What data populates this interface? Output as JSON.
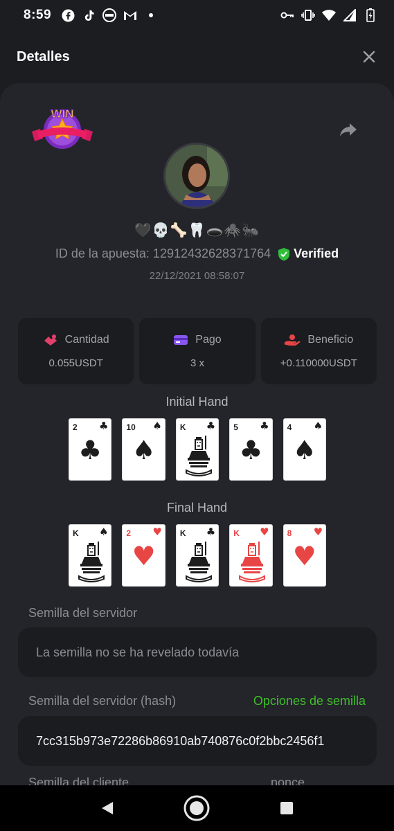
{
  "status": {
    "time": "8:59"
  },
  "header": {
    "title": "Detalles"
  },
  "bet": {
    "emojis": "🖤💀🦴🦷🕳️🕷️🐜",
    "id_text": "ID de la apuesta: 12912432628371764",
    "verified_label": "Verified",
    "date": "22/12/2021 08:58:07",
    "badge_text": "WIN"
  },
  "stats": [
    {
      "label": "Cantidad",
      "value": "0.055USDT",
      "icon": "coins-icon",
      "color": "#e0406a"
    },
    {
      "label": "Pago",
      "value": "3 x",
      "icon": "card-icon",
      "color": "#8a56f0"
    },
    {
      "label": "Beneficio",
      "value": "+0.110000USDT",
      "icon": "profit-hand-icon",
      "color": "#e84545"
    }
  ],
  "initial_hand": {
    "title": "Initial Hand",
    "cards": [
      {
        "rank": "2",
        "suit": "♣",
        "color": "black"
      },
      {
        "rank": "10",
        "suit": "♠",
        "color": "black"
      },
      {
        "rank": "K",
        "suit": "♣",
        "color": "black"
      },
      {
        "rank": "5",
        "suit": "♣",
        "color": "black"
      },
      {
        "rank": "4",
        "suit": "♠",
        "color": "black"
      }
    ]
  },
  "final_hand": {
    "title": "Final Hand",
    "cards": [
      {
        "rank": "K",
        "suit": "♠",
        "color": "black"
      },
      {
        "rank": "2",
        "suit": "♥",
        "color": "red"
      },
      {
        "rank": "K",
        "suit": "♣",
        "color": "black"
      },
      {
        "rank": "K",
        "suit": "♥",
        "color": "red"
      },
      {
        "rank": "8",
        "suit": "♥",
        "color": "red"
      }
    ]
  },
  "server_seed": {
    "label": "Semilla del servidor",
    "value": "La semilla no se ha revelado todavía"
  },
  "server_seed_hash": {
    "label": "Semilla del servidor (hash)",
    "options_link": "Opciones de semilla",
    "value": "7cc315b973e72286b86910ab740876c0f2bbc2456f1"
  },
  "client_seed": {
    "label": "Semilla del cliente",
    "nonce_label": "nonce"
  },
  "colors": {
    "accent_green": "#3fbf2a",
    "background": "#1c1d21",
    "card": "#24252a"
  }
}
